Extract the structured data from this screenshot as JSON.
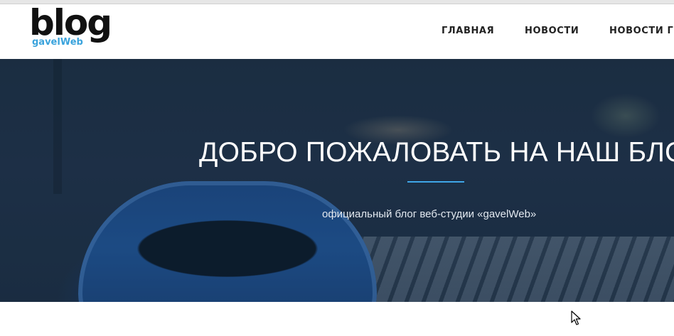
{
  "logo": {
    "word": "blog",
    "sub": "gavelWeb"
  },
  "nav": {
    "items": [
      "ГЛАВНАЯ",
      "НОВОСТИ",
      "НОВОСТИ Г"
    ]
  },
  "hero": {
    "title": "ДОБРО ПОЖАЛОВАТЬ НА НАШ БЛОГ!",
    "subtitle": "официальный блог веб-студии «gavelWeb»"
  },
  "colors": {
    "accent": "#3fa6e8",
    "logo_blue": "#3aa3dc",
    "nav_text": "#222222"
  },
  "icons": {
    "cursor": "mouse-pointer-icon"
  }
}
